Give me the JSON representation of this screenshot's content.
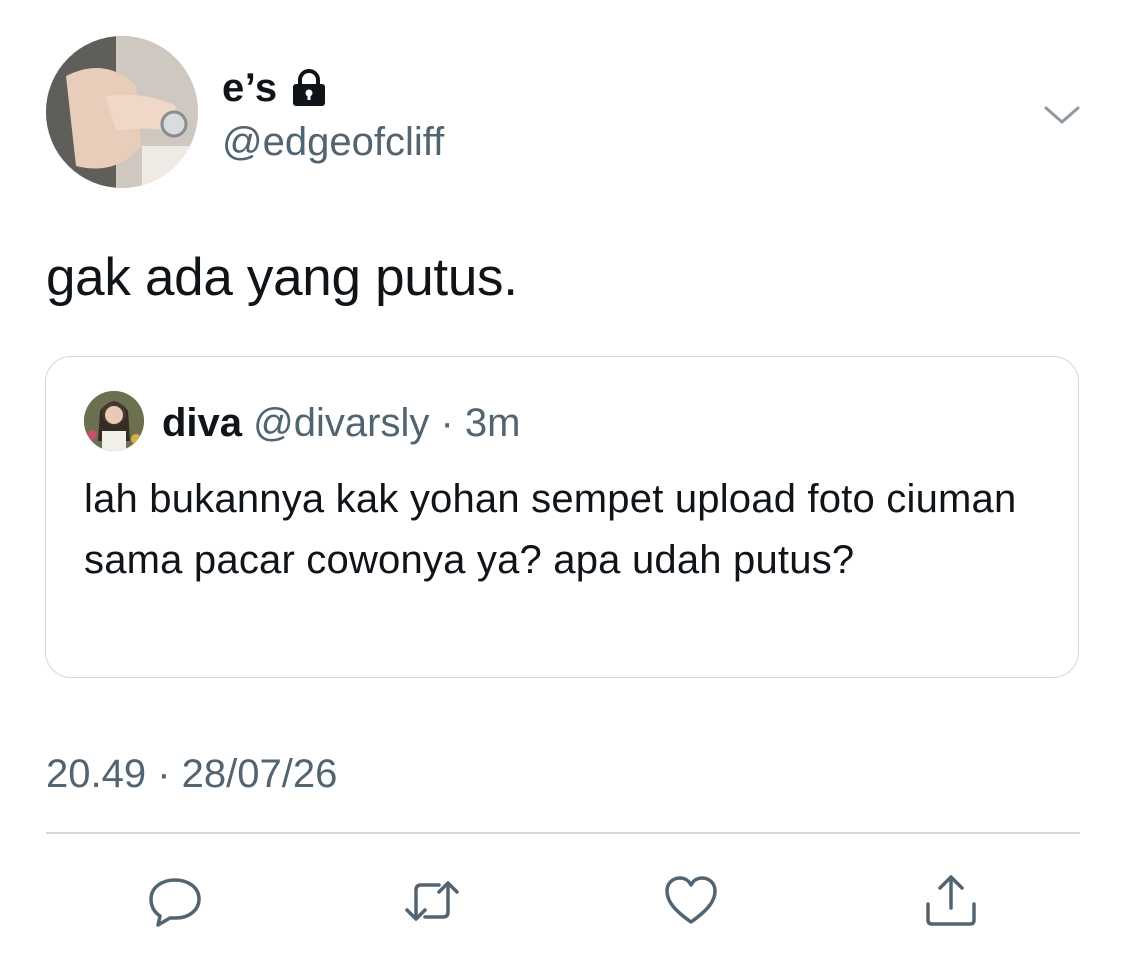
{
  "author": {
    "display_name": "e’s",
    "handle": "@edgeofcliff",
    "protected_icon": "lock-icon"
  },
  "tweet": {
    "text": "gak ada yang putus.",
    "timestamp": "20.49 · 28/07/26"
  },
  "quoted_tweet": {
    "display_name": "diva",
    "handle": "@divarsly",
    "separator": " · ",
    "age": "3m",
    "text": "lah bukannya kak yohan sempet upload foto ciuman sama pacar cowonya ya? apa udah putus?"
  },
  "actions": [
    {
      "name": "reply",
      "icon": "reply-icon"
    },
    {
      "name": "retweet",
      "icon": "retweet-icon"
    },
    {
      "name": "like",
      "icon": "heart-icon"
    },
    {
      "name": "share",
      "icon": "share-icon"
    }
  ],
  "colors": {
    "text_primary": "#0f1419",
    "text_secondary": "#536471",
    "border": "#cfd9de",
    "background": "#ffffff"
  }
}
